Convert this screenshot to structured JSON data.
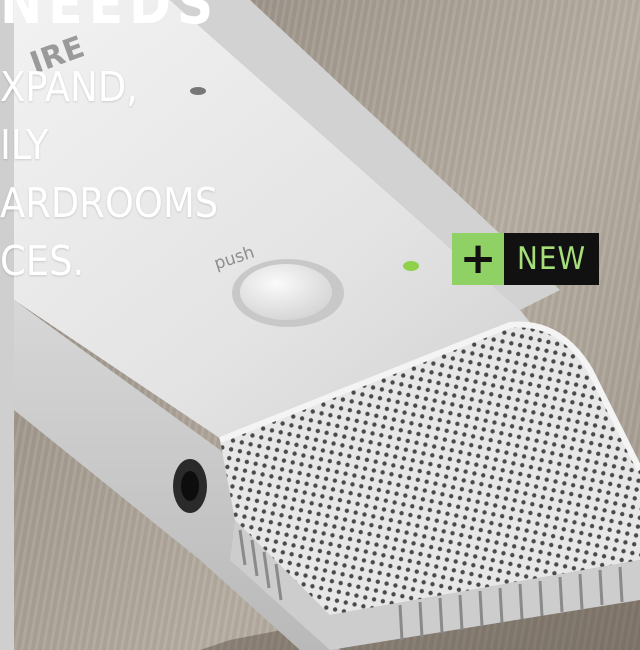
{
  "headline": {
    "top_word": "NEEDS",
    "lines": [
      "XPAND,",
      "ILY",
      "ARDROOMS",
      "CES."
    ]
  },
  "product": {
    "button_label": "push",
    "brand_fragment": "IRE"
  },
  "badge": {
    "plus_symbol": "+",
    "label": "NEW"
  },
  "colors": {
    "badge_green": "#8fd165",
    "badge_text": "#a6df7a",
    "badge_bg": "#111111",
    "led": "#8fd14a",
    "device_white": "#e6e6e6"
  }
}
